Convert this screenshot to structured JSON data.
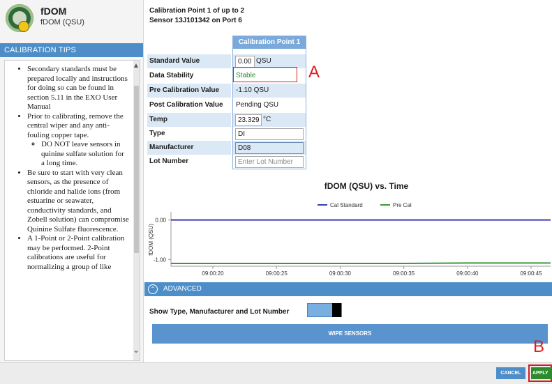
{
  "sensor": {
    "name": "fDOM",
    "subtitle": "fDOM (QSU)",
    "icon": "fdom-sensor-logo"
  },
  "tips": {
    "header": "CALIBRATION TIPS",
    "items": [
      {
        "text": "Secondary standards must be prepared locally and instructions for doing so can be found in section 5.11 in the EXO User Manual"
      },
      {
        "text": "Prior to calibrating, remove the central wiper and any anti-fouling copper tape.",
        "sub": "DO NOT leave sensors in quinine sulfate solution for a long time."
      },
      {
        "text": "Be sure to start with very clean sensors, as the presence of chloride and halide ions (from estuarine or seawater, conductivity standards, and Zobell solution) can compromise Quinine Sulfate fluorescence."
      },
      {
        "text": "A 1-Point or 2-Point calibration may be performed. 2-Point calibrations are useful for normalizing a group of like"
      }
    ]
  },
  "calibration": {
    "title": "Calibration Point  1  of up to  2",
    "subtitle": "Sensor 13J101342 on Port 6",
    "column_header": "Calibration Point 1",
    "rows": {
      "standard_value": {
        "label": "Standard Value",
        "value": "0.00",
        "unit": "QSU"
      },
      "data_stability": {
        "label": "Data Stability",
        "value": "Stable"
      },
      "pre_cal": {
        "label": "Pre Calibration Value",
        "value": "-1.10 QSU"
      },
      "post_cal": {
        "label": "Post Calibration Value",
        "value": "Pending QSU"
      },
      "temp": {
        "label": "Temp",
        "value": "23.329",
        "unit": "°C"
      },
      "type": {
        "label": "Type",
        "value": "DI"
      },
      "manufacturer": {
        "label": "Manufacturer",
        "value": "D08"
      },
      "lot_number": {
        "label": "Lot Number",
        "placeholder": "Enter Lot Number"
      }
    }
  },
  "markers": {
    "a": "A",
    "b": "B"
  },
  "chart_data": {
    "type": "line",
    "title": "fDOM (QSU) vs. Time",
    "ylabel": "fDOM (QSU)",
    "xlabel": "",
    "x": [
      "09:00:20",
      "09:00:25",
      "09:00:30",
      "09:00:35",
      "09:00:40",
      "09:00:45"
    ],
    "ylim": [
      -1.1,
      0.1
    ],
    "yticks": [
      "0.00",
      "-1.00"
    ],
    "legend_position": "top-center",
    "series": [
      {
        "name": "Cal Standard",
        "color": "#3b3bb0",
        "values": [
          0,
          0,
          0,
          0,
          0,
          0
        ]
      },
      {
        "name": "Pre Cal",
        "color": "#3a9a3a",
        "values": [
          -1.1,
          -1.1,
          -1.1,
          -1.1,
          -1.09,
          -1.09
        ]
      }
    ]
  },
  "advanced": {
    "label": "ADVANCED",
    "icon": "chevron-circle-icon"
  },
  "show_type_label": "Show Type, Manufacturer and Lot Number",
  "wipe_label": "WIPE SENSORS",
  "footer": {
    "cancel": "CANCEL",
    "apply": "APPLY"
  },
  "colors": {
    "accent": "#4d8ec9",
    "marker": "#e31b1b",
    "apply": "#2e8a2e"
  }
}
